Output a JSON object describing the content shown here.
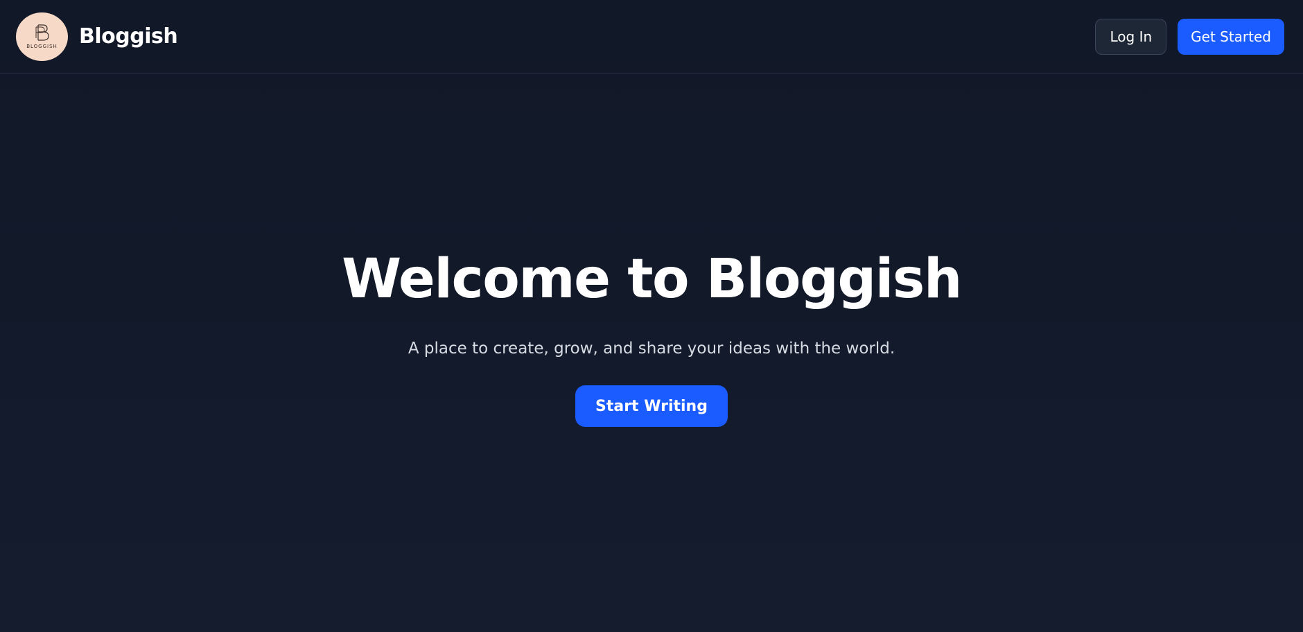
{
  "header": {
    "brand_name": "Bloggish",
    "logo_text": "BLOGGISH",
    "login_label": "Log In",
    "get_started_label": "Get Started"
  },
  "hero": {
    "title": "Welcome to Bloggish",
    "subtitle": "A place to create, grow, and share your ideas with the world.",
    "cta_label": "Start Writing"
  },
  "colors": {
    "background": "#121a2b",
    "accent": "#1a5cff",
    "logo_bg": "#f7d9c7"
  },
  "icons": {
    "logo": "bloggish-logo-icon"
  }
}
